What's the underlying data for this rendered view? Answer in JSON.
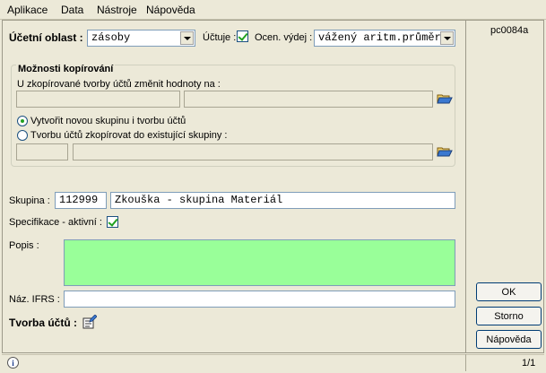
{
  "menu": {
    "items": [
      "Aplikace",
      "Data",
      "Nástroje",
      "Nápověda"
    ]
  },
  "form_id": "pc0084a",
  "ucetni_oblast": {
    "label": "Účetní oblast :",
    "value": "zásoby"
  },
  "uctuje": {
    "label": "Účtuje :",
    "checked": true
  },
  "ocen_vydej": {
    "label": "Ocen. výdej :",
    "value": "vážený aritm.průměr"
  },
  "copy_options": {
    "title": "Možnosti kopírování",
    "change_label": "U zkopírované tvorby účtů změnit hodnoty na :",
    "radio_new": "Vytvořit novou skupinu i tvorbu účtů",
    "radio_existing": "Tvorbu účtů zkopírovat do existující skupiny :",
    "selected": "new"
  },
  "skupina": {
    "label": "Skupina :",
    "code": "112999",
    "name": "Zkouška - skupina Materiál"
  },
  "specifikace": {
    "label": "Specifikace - aktivní :",
    "checked": true
  },
  "popis": {
    "label": "Popis :",
    "value": ""
  },
  "naz_ifrs": {
    "label": "Náz. IFRS :",
    "value": ""
  },
  "tvorba_uctu": {
    "label": "Tvorba účtů :"
  },
  "buttons": {
    "ok": "OK",
    "storno": "Storno",
    "napoveda": "Nápověda"
  },
  "status": {
    "page": "1/1"
  },
  "colors": {
    "popis_bg": "#99ff99",
    "window_bg": "#ece9d8"
  }
}
